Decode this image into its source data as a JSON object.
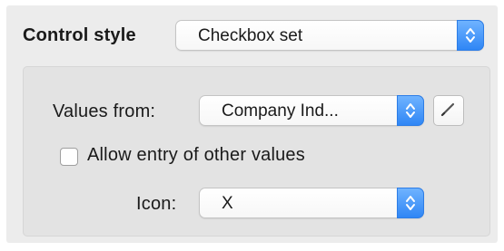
{
  "control_style": {
    "label": "Control style",
    "selected": "Checkbox set"
  },
  "values_from": {
    "label": "Values from:",
    "selected": "Company Ind..."
  },
  "allow_other": {
    "label": "Allow entry of other values",
    "checked": false
  },
  "icon": {
    "label": "Icon:",
    "selected": "X"
  },
  "colors": {
    "accent": "#2f86f5",
    "panel": "#ececec",
    "inner_group": "#e3e3e3"
  }
}
